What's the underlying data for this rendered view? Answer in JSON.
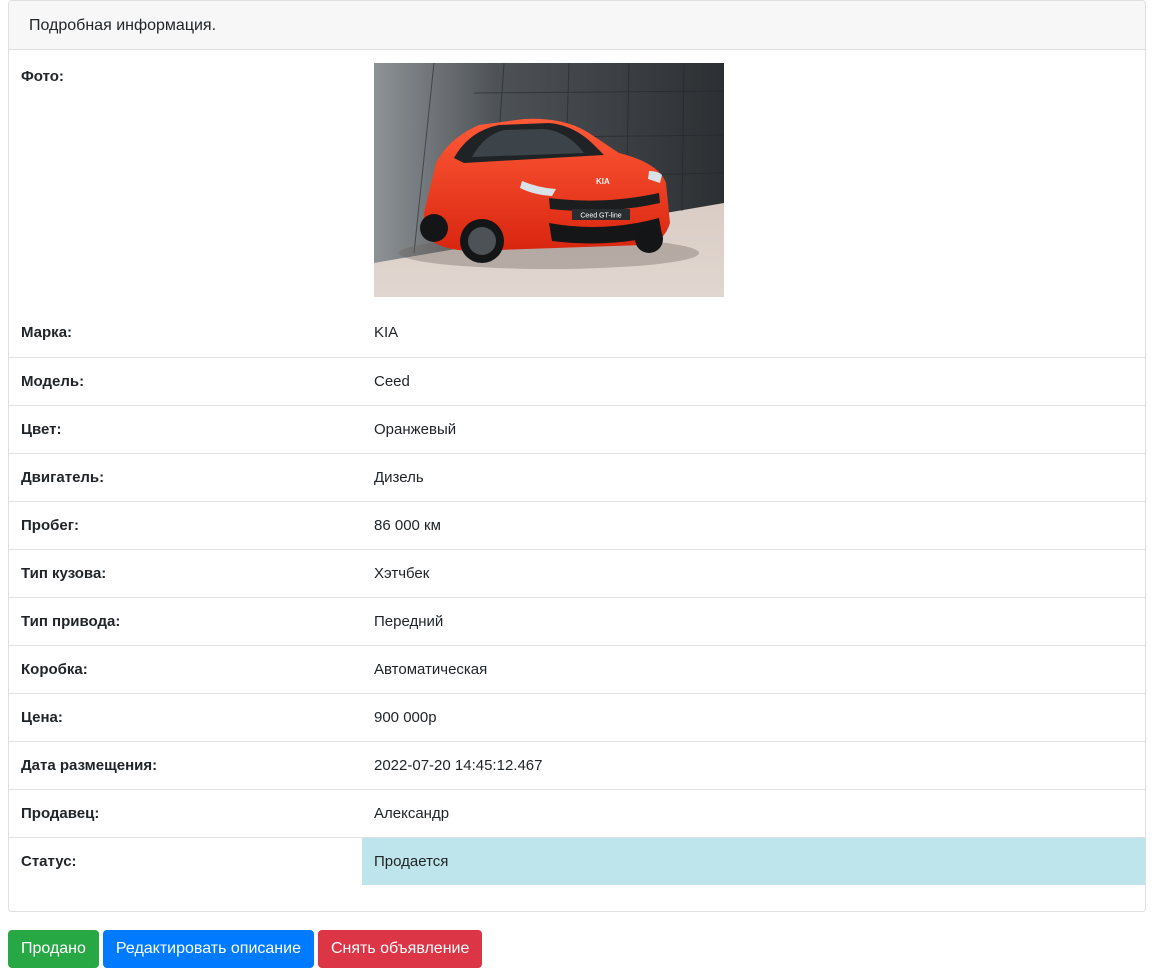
{
  "card": {
    "header": "Подробная информация."
  },
  "details": {
    "photo_label": "Фото:",
    "photo_alt": "Kia Ceed GT-line orange hatchback",
    "plate_text": "Ceed GT-line",
    "rows": [
      {
        "label": "Марка:",
        "value": "KIA"
      },
      {
        "label": "Модель:",
        "value": "Ceed"
      },
      {
        "label": "Цвет:",
        "value": "Оранжевый"
      },
      {
        "label": "Двигатель:",
        "value": "Дизель"
      },
      {
        "label": "Пробег:",
        "value": "86 000 км"
      },
      {
        "label": "Тип кузова:",
        "value": "Хэтчбек"
      },
      {
        "label": "Тип привода:",
        "value": "Передний"
      },
      {
        "label": "Коробка:",
        "value": "Автоматическая"
      },
      {
        "label": "Цена:",
        "value": "900 000р"
      },
      {
        "label": "Дата размещения:",
        "value": "2022-07-20 14:45:12.467"
      },
      {
        "label": "Продавец:",
        "value": "Александр"
      },
      {
        "label": "Статус:",
        "value": "Продается"
      }
    ]
  },
  "actions": {
    "sold_label": "Продано",
    "edit_label": "Редактировать описание",
    "remove_label": "Снять объявление"
  },
  "colors": {
    "status_bg": "#bee5eb",
    "success": "#28a745",
    "primary": "#007bff",
    "danger": "#dc3545",
    "car_body": "#ff3a1f"
  }
}
